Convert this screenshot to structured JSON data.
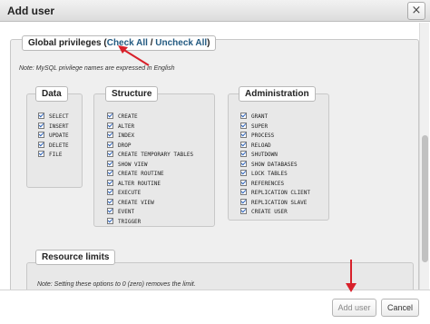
{
  "dialog": {
    "title": "Add user",
    "close_glyph": "×"
  },
  "global_privileges": {
    "label": "Global privileges",
    "open_paren": "(",
    "check_all": "Check All",
    "separator": " / ",
    "uncheck_all": "Uncheck All",
    "close_paren": ")",
    "note": "Note: MySQL privilege names are expressed in English"
  },
  "groups": {
    "data": {
      "label": "Data",
      "items": [
        "SELECT",
        "INSERT",
        "UPDATE",
        "DELETE",
        "FILE"
      ]
    },
    "structure": {
      "label": "Structure",
      "items": [
        "CREATE",
        "ALTER",
        "INDEX",
        "DROP",
        "CREATE TEMPORARY TABLES",
        "SHOW VIEW",
        "CREATE ROUTINE",
        "ALTER ROUTINE",
        "EXECUTE",
        "CREATE VIEW",
        "EVENT",
        "TRIGGER"
      ]
    },
    "administration": {
      "label": "Administration",
      "items": [
        "GRANT",
        "SUPER",
        "PROCESS",
        "RELOAD",
        "SHUTDOWN",
        "SHOW DATABASES",
        "LOCK TABLES",
        "REFERENCES",
        "REPLICATION CLIENT",
        "REPLICATION SLAVE",
        "CREATE USER"
      ]
    }
  },
  "resource_limits": {
    "label": "Resource limits",
    "note": "Note: Setting these options to 0 (zero) removes the limit."
  },
  "footer": {
    "add_user": "Add user",
    "cancel": "Cancel"
  },
  "colors": {
    "accent_link": "#235a81",
    "annotation_arrow": "#d8202a",
    "checkbox_check": "#2a60b8"
  },
  "icons": {
    "close": "close-icon",
    "checkbox": "checkbox-checked-icon",
    "arrow": "red-arrow-annotation"
  }
}
